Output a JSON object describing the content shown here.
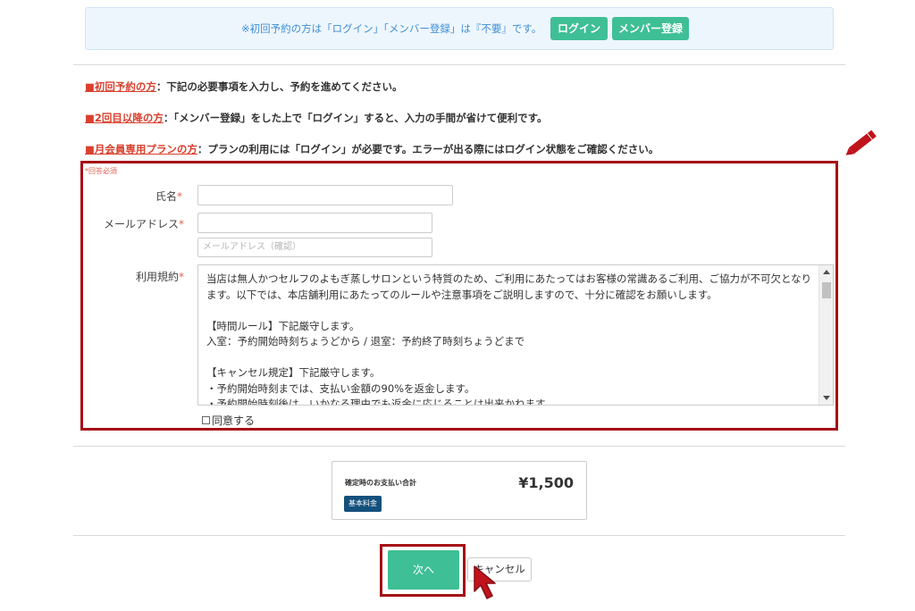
{
  "notice": {
    "text": "※初回予約の方は「ログイン」「メンバー登録」は『不要』です。",
    "login_label": "ログイン",
    "member_label": "メンバー登録"
  },
  "info": [
    {
      "lead": "■初回予約の方",
      "text": "：下記の必要事項を入力し、予約を進めてください。"
    },
    {
      "lead": "■2回目以降の方",
      "text": "：「メンバー登録」をした上で「ログイン」すると、入力の手間が省けて便利です。"
    },
    {
      "lead": "■月会員専用プランの方",
      "text": "：プランの利用には「ログイン」が必要です。エラーが出る際にはログイン状態をご確認ください。"
    }
  ],
  "form": {
    "required_note": "*回答必須",
    "required_mark": "*",
    "name_label": "氏名",
    "name_value": "",
    "email_label": "メールアドレス",
    "email_value": "",
    "email_confirm_placeholder": "メールアドレス（確認）",
    "terms_label": "利用規約",
    "terms_lines": [
      "当店は無人かつセルフのよもぎ蒸しサロンという特質のため、ご利用にあたってはお客様の常識あるご利用、ご協力が不可欠となります。以下では、本店舗利用にあたってのルールや注意事項をご説明しますので、十分に確認をお願いします。",
      "",
      "【時間ルール】下記厳守します。",
      "入室：予約開始時刻ちょうどから / 退室：予約終了時刻ちょうどまで",
      "",
      "【キャンセル規定】下記厳守します。",
      "・予約開始時刻までは、支払い金額の90%を返金します。",
      "・予約開始時刻後は、いかなる理由でも返金に応じることは出来かねます。"
    ],
    "agree_label": "同意する",
    "agree_checked": false
  },
  "payment": {
    "label": "確定時のお支払い合計",
    "amount": "¥1,500",
    "badge": "基本料金"
  },
  "actions": {
    "next_label": "次へ",
    "cancel_label": "キャンセル"
  },
  "colors": {
    "accent_green": "#3fbf95",
    "highlight_red": "#a50f17",
    "lead_red": "#d9402e",
    "badge_navy": "#14507d"
  }
}
